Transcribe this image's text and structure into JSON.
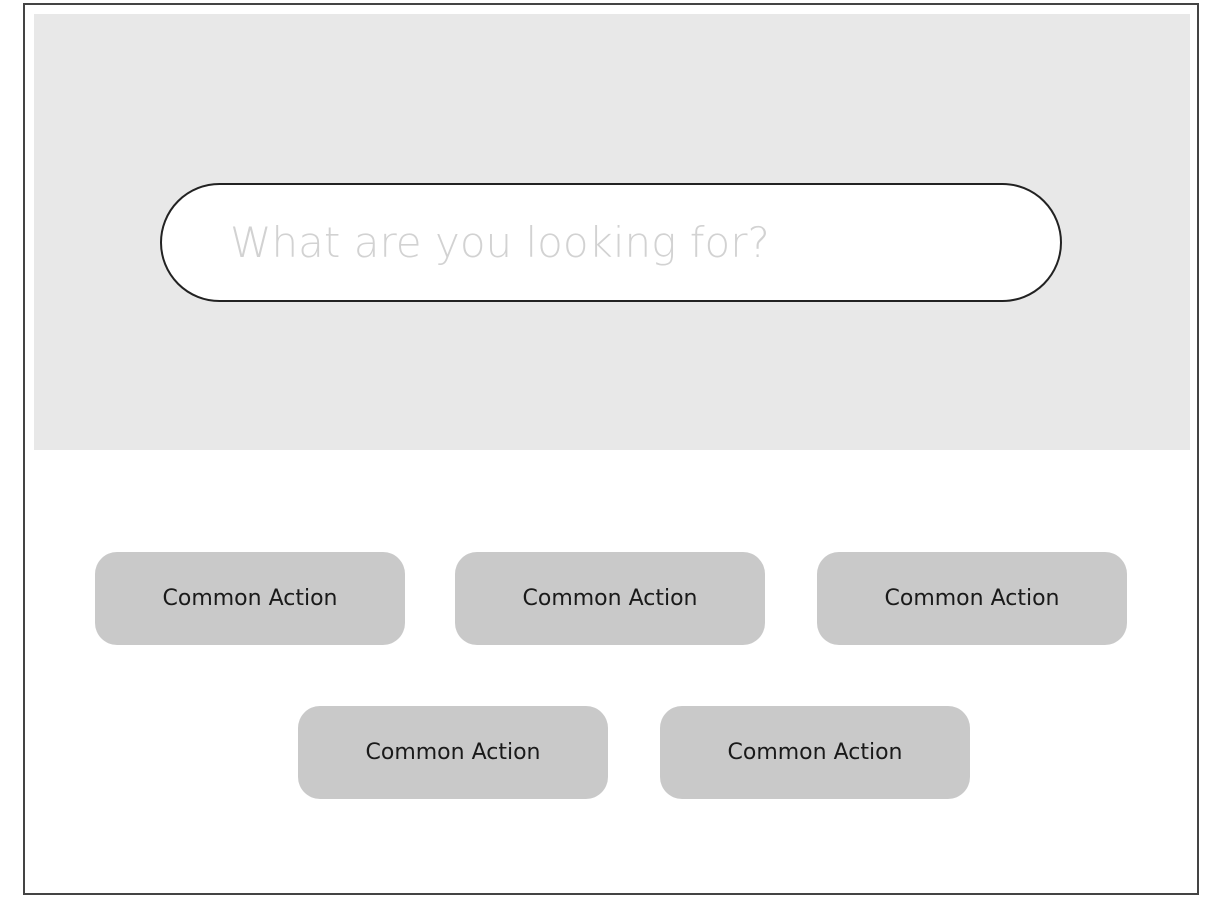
{
  "search": {
    "placeholder": "What are you looking for?",
    "value": ""
  },
  "actions": [
    {
      "label": "Common Action"
    },
    {
      "label": "Common Action"
    },
    {
      "label": "Common Action"
    },
    {
      "label": "Common Action"
    },
    {
      "label": "Common Action"
    }
  ],
  "colors": {
    "hero_background": "#e8e8e8",
    "button_background": "#c9c9c9",
    "search_border": "#222222",
    "placeholder_text": "#d2d2d2"
  }
}
